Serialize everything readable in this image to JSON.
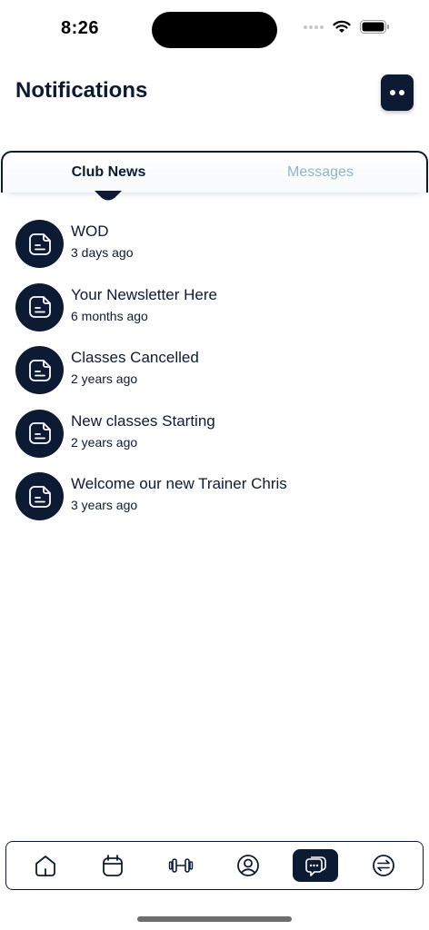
{
  "status_bar": {
    "time": "8:26",
    "icons": [
      "signal-icon",
      "wifi-icon",
      "battery-icon"
    ]
  },
  "header": {
    "title": "Notifications",
    "menu_icon": "more-icon"
  },
  "tabs": [
    {
      "label": "Club News",
      "active": true
    },
    {
      "label": "Messages",
      "active": false
    }
  ],
  "news": [
    {
      "title": "WOD",
      "time": "3 days ago",
      "icon": "document-icon"
    },
    {
      "title": "Your Newsletter Here",
      "time": "6 months ago",
      "icon": "document-icon"
    },
    {
      "title": "Classes Cancelled",
      "time": "2 years ago",
      "icon": "document-icon"
    },
    {
      "title": "New classes Starting",
      "time": "2 years ago",
      "icon": "document-icon"
    },
    {
      "title": "Welcome our new Trainer Chris",
      "time": "3 years ago",
      "icon": "document-icon"
    }
  ],
  "bottom_nav": [
    {
      "name": "home",
      "icon": "home-icon",
      "active": false
    },
    {
      "name": "calendar",
      "icon": "calendar-icon",
      "active": false
    },
    {
      "name": "workouts",
      "icon": "dumbbell-icon",
      "active": false
    },
    {
      "name": "profile",
      "icon": "user-icon",
      "active": false
    },
    {
      "name": "notifications",
      "icon": "chat-icon",
      "active": true
    },
    {
      "name": "switch",
      "icon": "switch-icon",
      "active": false
    }
  ],
  "colors": {
    "primary": "#0c1b33",
    "inactive_tab": "#8fb3c8",
    "background": "#ffffff"
  }
}
